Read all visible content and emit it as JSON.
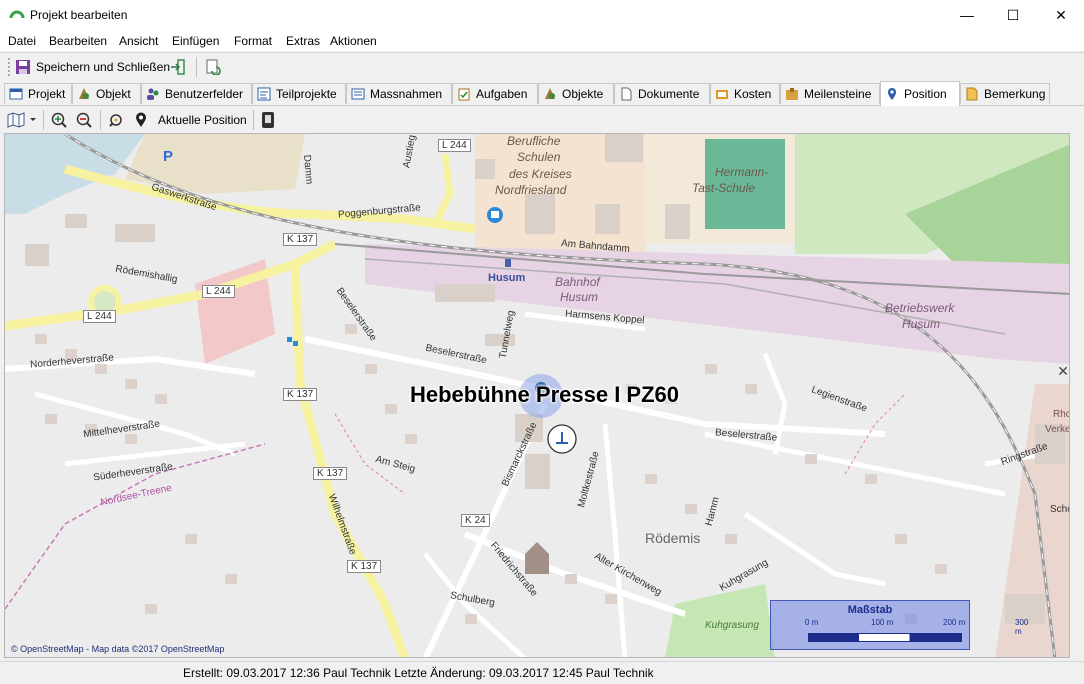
{
  "window": {
    "title": "Projekt bearbeiten",
    "minimize": "—",
    "maximize": "☐",
    "close": "✕"
  },
  "menu": [
    "Datei",
    "Bearbeiten",
    "Ansicht",
    "Einfügen",
    "Format",
    "Extras",
    "Aktionen"
  ],
  "toolbar": {
    "save_close_label": "Speichern und Schließen"
  },
  "tabs": [
    "Projekt",
    "Objekt",
    "Benutzerfelder",
    "Teilprojekte",
    "Massnahmen",
    "Aufgaben",
    "Objekte",
    "Dokumente",
    "Kosten",
    "Meilensteine",
    "Position",
    "Bemerkung"
  ],
  "active_tab": "Position",
  "map_toolbar": {
    "current_position_label": "Aktuelle Position"
  },
  "map": {
    "poi_label": "Hebebühne Presse I PZ60",
    "attribution": "© OpenStreetMap - Map data ©2017 OpenStreetMap",
    "scale": {
      "title": "Maßstab",
      "ticks": [
        "0 m",
        "100 m",
        "200 m",
        "300 m"
      ]
    },
    "labels": {
      "school1": "Berufliche",
      "school2": "Schulen",
      "school3": "des Kreises",
      "school4": "Nordfriesland",
      "hermann1": "Hermann-",
      "hermann2": "Tast-Schule",
      "bahnhof1": "Bahnhof",
      "bahnhof2": "Husum",
      "husum": "Husum",
      "betrieb1": "Betriebswerk",
      "betrieb2": "Husum",
      "rodemis": "Rödemis",
      "kuhgrasung": "Kuhgrasung",
      "gaswerk": "Gaswerkstraße",
      "poggen": "Poggenburgstraße",
      "ambahn": "Am Bahndamm",
      "harmsens": "Harmsens Koppel",
      "beseler1": "Beselerstraße",
      "beseler2": "Beselerstraße",
      "beseler3": "Beselerstraße",
      "norderhever": "Norderheverstraße",
      "mittelhever": "Mittelheverstraße",
      "suederhever": "Süderheverstraße",
      "nordsee": "Nordsee-Treene",
      "legien": "Legienstraße",
      "altkirchen": "Alter Kirchenweg",
      "schulberg": "Schulberg",
      "friedrich": "Friedrichstraße",
      "wilhelm": "Wilhelmstraße",
      "ringstr": "Ringstraße",
      "rodemishallig": "Rödemishallig",
      "amsteig": "Am Steig",
      "tunnelweg": "Tunnelweg",
      "bismarck": "Bismarckstraße",
      "moltke": "Moltkestraße",
      "hamm": "Hamm",
      "kuhgrasung2": "Kuhgrasung",
      "rhode": "Rhode",
      "verkehrs": "Verkehrsbe",
      "schock": "Schock",
      "damm": "Damm",
      "austieg": "Austieg",
      "l244a": "L 244",
      "l244b": "L 244",
      "l244c": "L 244",
      "k137a": "K 137",
      "k137b": "K 137",
      "k137c": "K 137",
      "k137d": "K 137",
      "k24": "K 24",
      "parking": "P"
    }
  },
  "status": {
    "text": "Erstellt: 09.03.2017 12:36 Paul Technik  Letzte Änderung: 09.03.2017 12:45 Paul Technik"
  }
}
